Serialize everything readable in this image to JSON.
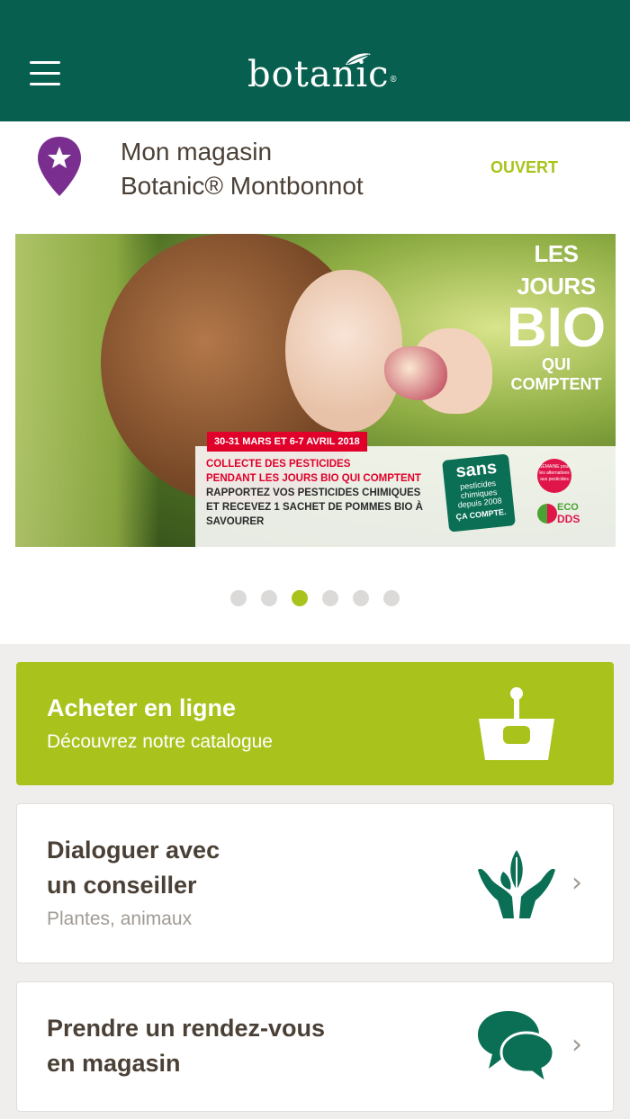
{
  "header": {
    "logo_text": "botanic",
    "logo_mark": "®",
    "menu_icon": "hamburger-menu-icon",
    "background_color": "#07604f"
  },
  "store": {
    "label": "Mon magasin",
    "name": "Botanic® Montbonnot",
    "status": "OUVERT",
    "status_color": "#a9c31c",
    "pin_icon": "location-pin-star-icon",
    "pin_color": "#7a2e8f"
  },
  "banner": {
    "title_line1": "LES JOURS",
    "title_line2": "BIO",
    "title_line3": "QUI COMPTENT",
    "date": "30-31 MARS ET  6-7 AVRIL 2018",
    "line1": "COLLECTE DES PESTICIDES",
    "line2": "PENDANT LES JOURS BIO QUI COMPTENT",
    "line3": "RAPPORTEZ VOS PESTICIDES CHIMIQUES",
    "line4": "ET RECEVEZ 1 SACHET DE POMMES BIO À",
    "line5": "SAVOURER",
    "badge_line1": "sans",
    "badge_line2": "pesticides",
    "badge_line3": "chimiques",
    "badge_line4": "depuis 2008",
    "badge_line5": "ÇA COMPTE.",
    "semaine_text": "SEMAINE pour les alternatives aux pesticides",
    "eco_line1": "ECO",
    "eco_line2": "DDS"
  },
  "carousel": {
    "count": 6,
    "active_index": 2
  },
  "cards": {
    "buy": {
      "title": "Acheter en ligne",
      "subtitle": "Découvrez notre catalogue",
      "icon": "basket-icon",
      "color": "#a9c31c"
    },
    "chat": {
      "title_line1": "Dialoguer avec",
      "title_line2": "un conseiller",
      "subtitle": "Plantes, animaux",
      "icon": "hands-plant-icon"
    },
    "rdv": {
      "title_line1": "Prendre un rendez-vous",
      "title_line2": "en magasin",
      "icon": "chat-bubbles-icon"
    },
    "chevron": "›"
  }
}
